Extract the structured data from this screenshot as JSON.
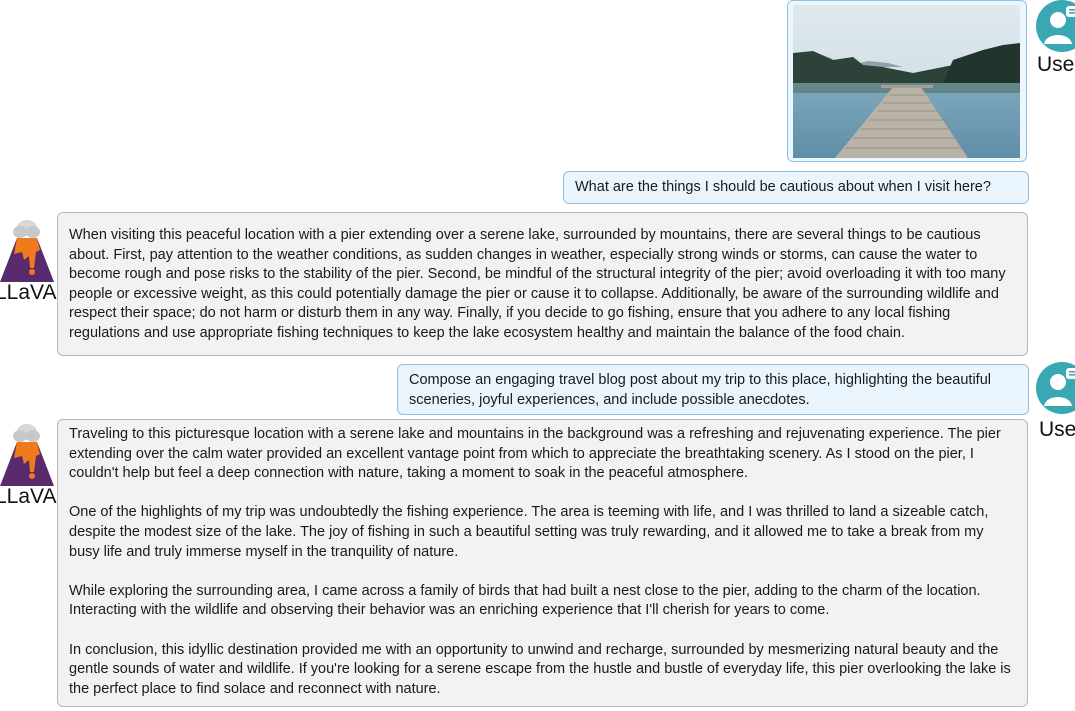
{
  "chat": {
    "user_label": "Use",
    "bot_label": "LLaVA",
    "messages": [
      {
        "role": "user",
        "type": "image",
        "icon": "lake-pier-photo"
      },
      {
        "role": "user",
        "type": "text",
        "text": "What are the things I should be cautious about when I visit here?"
      },
      {
        "role": "assistant",
        "paragraphs": [
          "When visiting this peaceful location with a pier extending over a serene lake, surrounded by mountains, there are several things to be cautious about. First, pay attention to the weather conditions, as sudden changes in weather, especially strong winds or storms, can cause the water to become rough and pose risks to the stability of the pier. Second, be mindful of the structural integrity of the pier; avoid overloading it with too many people or excessive weight, as this could potentially damage the pier or cause it to collapse. Additionally, be aware of the surrounding wildlife and respect their space; do not harm or disturb them in any way. Finally, if you decide to go fishing, ensure that you adhere to any local fishing regulations and use appropriate fishing techniques to keep the lake ecosystem healthy and maintain the balance of the food chain."
        ]
      },
      {
        "role": "user",
        "type": "text",
        "text": "Compose an engaging travel blog post about my trip to this place, highlighting the beautiful sceneries, joyful experiences, and include possible anecdotes."
      },
      {
        "role": "assistant",
        "paragraphs": [
          "Traveling to this picturesque location with a serene lake and mountains in the background was a refreshing and rejuvenating experience. The pier extending over the calm water provided an excellent vantage point from which to appreciate the breathtaking scenery. As I stood on the pier, I couldn't help but feel a deep connection with nature, taking a moment to soak in the peaceful atmosphere.",
          "One of the highlights of my trip was undoubtedly the fishing experience. The area is teeming with life, and I was thrilled to land a sizeable catch, despite the modest size of the lake. The joy of fishing in such a beautiful setting was truly rewarding, and it allowed me to take a break from my busy life and truly immerse myself in the tranquility of nature.",
          "While exploring the surrounding area, I came across a family of birds that had built a nest close to the pier, adding to the charm of the location. Interacting with the wildlife and observing their behavior was an enriching experience that I'll cherish for years to come.",
          "In conclusion, this idyllic destination provided me with an opportunity to unwind and recharge, surrounded by mesmerizing natural beauty and the gentle sounds of water and wildlife. If you're looking for a serene escape from the hustle and bustle of everyday life, this pier overlooking the lake is the perfect place to find solace and reconnect with nature."
        ]
      }
    ]
  },
  "colors": {
    "user_avatar": "#3aa8b3",
    "user_bubble_bg": "#eaf4fd",
    "user_bubble_border": "#8fc0e6",
    "bot_bubble_bg": "#f2f2f2",
    "bot_bubble_border": "#b8b8b8",
    "volcano_orange": "#f07a1c",
    "volcano_purple": "#5a2a6e"
  }
}
